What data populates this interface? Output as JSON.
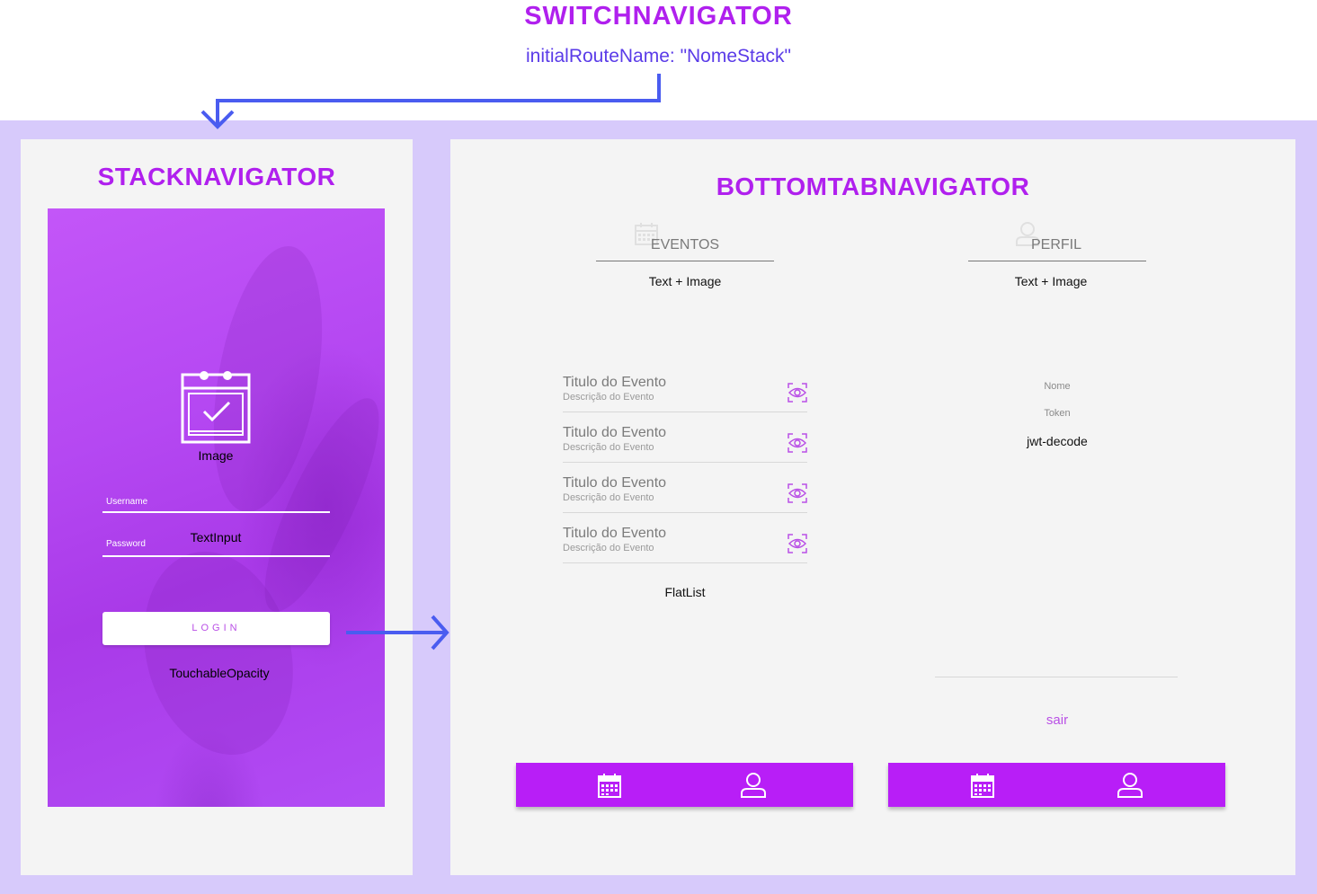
{
  "header": {
    "title": "SWITCHNAVIGATOR",
    "route": "initialRouteName: \"NomeStack\""
  },
  "stack": {
    "title": "STACKNAVIGATOR",
    "image_label": "Image",
    "username_label": "Username",
    "password_label": "Password",
    "textinput_label": "TextInput",
    "login_button": "LOGIN",
    "touchable_label": "TouchableOpacity"
  },
  "tabs": {
    "title": "BOTTOMTABNAVIGATOR",
    "eventos": {
      "header": "EVENTOS",
      "caption": "Text + Image",
      "list_caption": "FlatList",
      "items": [
        {
          "title": "Titulo do Evento",
          "desc": "Descrição do Evento"
        },
        {
          "title": "Titulo do Evento",
          "desc": "Descrição do Evento"
        },
        {
          "title": "Titulo do Evento",
          "desc": "Descrição do Evento"
        },
        {
          "title": "Titulo do Evento",
          "desc": "Descrição do Evento"
        }
      ]
    },
    "perfil": {
      "header": "PERFIL",
      "caption": "Text + Image",
      "nome_label": "Nome",
      "token_label": "Token",
      "decode_label": "jwt-decode",
      "sair": "sair"
    },
    "tabbar_icons": [
      "calendar-icon",
      "user-icon"
    ]
  },
  "colors": {
    "accent": "#b020ee",
    "route": "#5a3be8",
    "arrow": "#4a5cf0",
    "band": "#d7cafb",
    "tabbar": "#b81ef7"
  }
}
